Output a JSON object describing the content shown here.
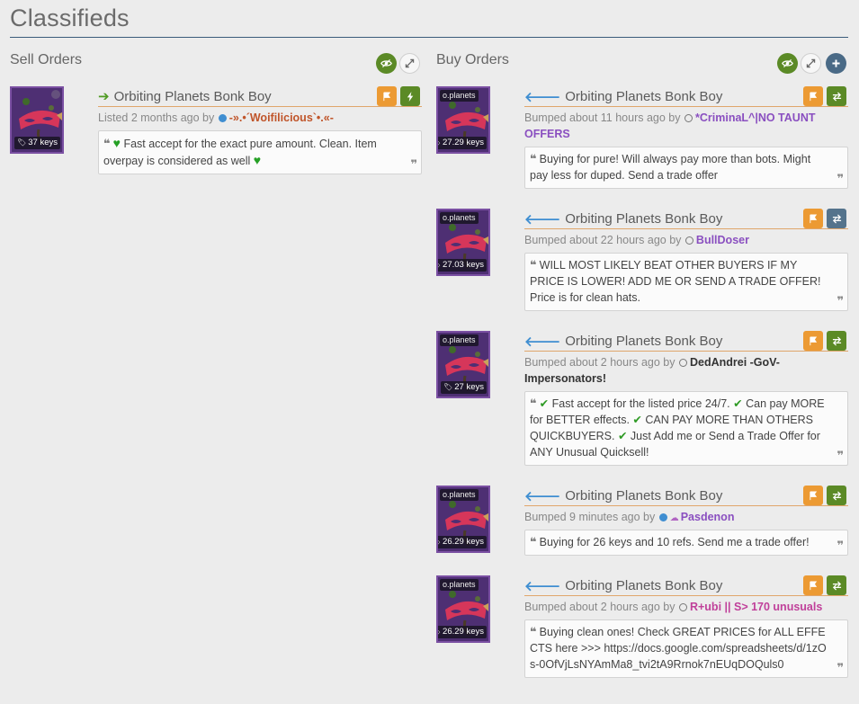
{
  "page": {
    "title": "Classifieds"
  },
  "sell": {
    "header": "Sell Orders",
    "listings": [
      {
        "item": "Orbiting Planets Bonk Boy",
        "effect": "",
        "price": "37 keys",
        "meta_prefix": "Listed 2 months ago by",
        "user": "-».•´Woifilicious`•.«-",
        "user_color": "#c0552a",
        "status": "online",
        "comment_parts": [
          "",
          "Fast accept for the exact pure amount. Clean. Item overpay is considered as well",
          ""
        ]
      }
    ]
  },
  "buy": {
    "header": "Buy Orders",
    "listings": [
      {
        "item": "Orbiting Planets Bonk Boy",
        "effect": "o.planets",
        "price": "27.29 keys",
        "meta_prefix": "Bumped about 11 hours ago by",
        "user": "*CriminaL^|NO TAUNT OFFERS",
        "user_color": "#8a4fc0",
        "status": "offline",
        "comment": "Buying for pure! Will always pay more than bots. Might pay less for duped. Send a trade offer"
      },
      {
        "item": "Orbiting Planets Bonk Boy",
        "effect": "o.planets",
        "price": "27.03 keys",
        "meta_prefix": "Bumped about 22 hours ago by",
        "user": "BullDoser",
        "user_color": "#8a4fc0",
        "status": "offline",
        "comment": "WILL MOST LIKELY BEAT OTHER BUYERS IF MY PRICE IS LOWER! ADD ME OR SEND A TRADE OFFER! Price is for clean hats."
      },
      {
        "item": "Orbiting Planets Bonk Boy",
        "effect": "o.planets",
        "price": "27 keys",
        "meta_prefix": "Bumped about 2 hours ago by",
        "user": "DedAndrei -GoV- Impersonators!",
        "user_color": "#333333",
        "status": "offline",
        "comment_parts": [
          "Fast accept for the listed price 24/7.",
          "Can pay MORE for BETTER effects.",
          "CAN PAY MORE THAN OTHERS QUICKBUYERS.",
          "Just Add me or Send a Trade Offer for ANY Unusual Quicksell!"
        ]
      },
      {
        "item": "Orbiting Planets Bonk Boy",
        "effect": "o.planets",
        "price": "26.29 keys",
        "meta_prefix": "Bumped 9 minutes ago by",
        "user": "Pasdenon",
        "user_color": "#8a4fc0",
        "status": "online",
        "comment": "Buying for 26 keys and 10 refs. Send me a trade offer!"
      },
      {
        "item": "Orbiting Planets Bonk Boy",
        "effect": "o.planets",
        "price": "26.29 keys",
        "meta_prefix": "Bumped about 2 hours ago by",
        "user": "R+ubi || S> 170 unusuals",
        "user_color": "#c0409a",
        "status": "offline",
        "comment": "Buying clean ones! Check GREAT PRICES for ALL EFFECTS here >>> https://docs.google.com/spreadsheets/d/1zOs-0OfVjLsNYAmMa8_tvi2tA9Rrnok7nEUqDOQuls0"
      }
    ]
  },
  "colors": {
    "accent_orange": "#ec9a33",
    "accent_green": "#5b8a26",
    "accent_slate": "#54738c",
    "item_bg": "#4e2f73"
  },
  "icons": {
    "eye": "eye-icon",
    "expand": "expand-icon",
    "add": "plus-icon",
    "flag": "flag-icon",
    "lightning": "lightning-icon",
    "trade": "swap-icon"
  }
}
